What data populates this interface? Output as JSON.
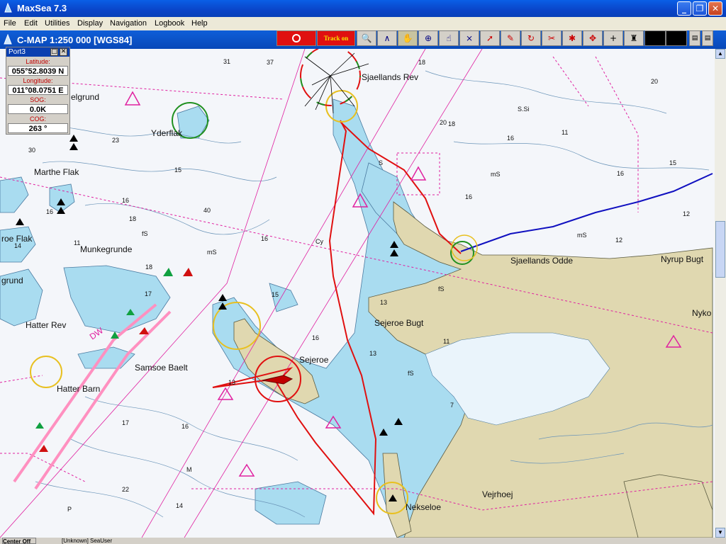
{
  "window": {
    "title": "MaxSea 7.3"
  },
  "menu": [
    "File",
    "Edit",
    "Utilities",
    "Display",
    "Navigation",
    "Logbook",
    "Help"
  ],
  "chart_header": {
    "title": "C-MAP  1:250 000 [WGS84]"
  },
  "toolbar": {
    "track_label": "Track on"
  },
  "port_panel": {
    "title": "Port3",
    "latitude_label": "Latitude:",
    "latitude": "055°52.8039 N",
    "longitude_label": "Longitude:",
    "longitude": "011°08.0751 E",
    "sog_label": "SOG:",
    "sog": "0.0K",
    "cog_label": "COG:",
    "cog": "263 °"
  },
  "places": {
    "sjaellands_rev": "Sjaellands Rev",
    "elgrund": "elgrund",
    "yderflak": "Yderflak",
    "marthe_flak": "Marthe Flak",
    "munkegrunde": "Munkegrunde",
    "roe_flak": "roe Flak",
    "grund": "grund",
    "hatter_rev": "Hatter Rev",
    "hatter_barn": "Hatter Barn",
    "samsoe_baelt": "Samsoe Baelt",
    "sejeroe": "Sejeroe",
    "sejeroe_bugt": "Sejeroe Bugt",
    "sjaellands_odde": "Sjaellands Odde",
    "nyrup_bugt": "Nyrup Bugt",
    "nyko": "Nyko",
    "vejrhoej": "Vejrhoej",
    "nekseloe": "Nekseloe",
    "ssi": "S.Si",
    "dw": "DW"
  },
  "depths": [
    "37",
    "16",
    "18",
    "31",
    "20",
    "23",
    "30",
    "15",
    "16",
    "40",
    "14",
    "11",
    "17",
    "18",
    "13",
    "16",
    "11",
    "16",
    "17",
    "22",
    "14",
    "16",
    "13",
    "15",
    "12",
    "16",
    "20",
    "18",
    "12",
    "16",
    "15",
    "11",
    "7",
    "13",
    "18",
    "16",
    "M",
    "P",
    "mS",
    "mS",
    "mS",
    "fS",
    "fS",
    "fS",
    "Cy",
    "S"
  ],
  "statusbar": {
    "center": "Center Off",
    "user": "[Unknown] SeaUser"
  }
}
